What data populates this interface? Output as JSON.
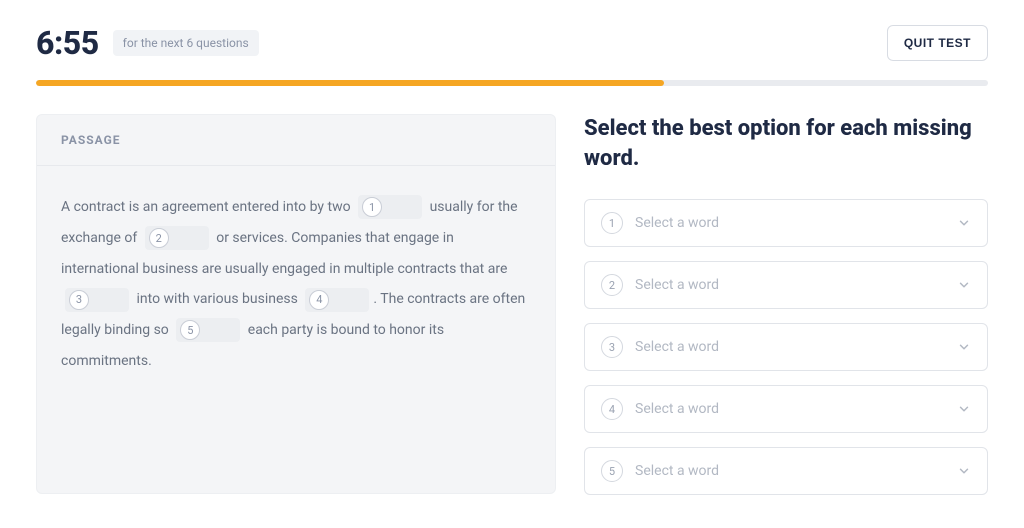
{
  "header": {
    "timer": "6:55",
    "timer_note": "for the next 6 questions",
    "quit_label": "QUIT TEST"
  },
  "progress": {
    "percent": 66,
    "fill_color": "#f5a623"
  },
  "passage": {
    "title": "PASSAGE",
    "segments": [
      "A contract is an agreement entered into by two",
      "usually for the exchange of",
      "or services. Companies that engage in international business are usually engaged in multiple contracts that are",
      "into with various business",
      ". The contracts are often legally binding so",
      "each party is bound to honor its commitments."
    ],
    "blanks": [
      "1",
      "2",
      "3",
      "4",
      "5"
    ]
  },
  "question": {
    "instruction": "Select the best option for each missing word.",
    "select_placeholder": "Select a word",
    "options": [
      {
        "num": "1"
      },
      {
        "num": "2"
      },
      {
        "num": "3"
      },
      {
        "num": "4"
      },
      {
        "num": "5"
      }
    ]
  }
}
